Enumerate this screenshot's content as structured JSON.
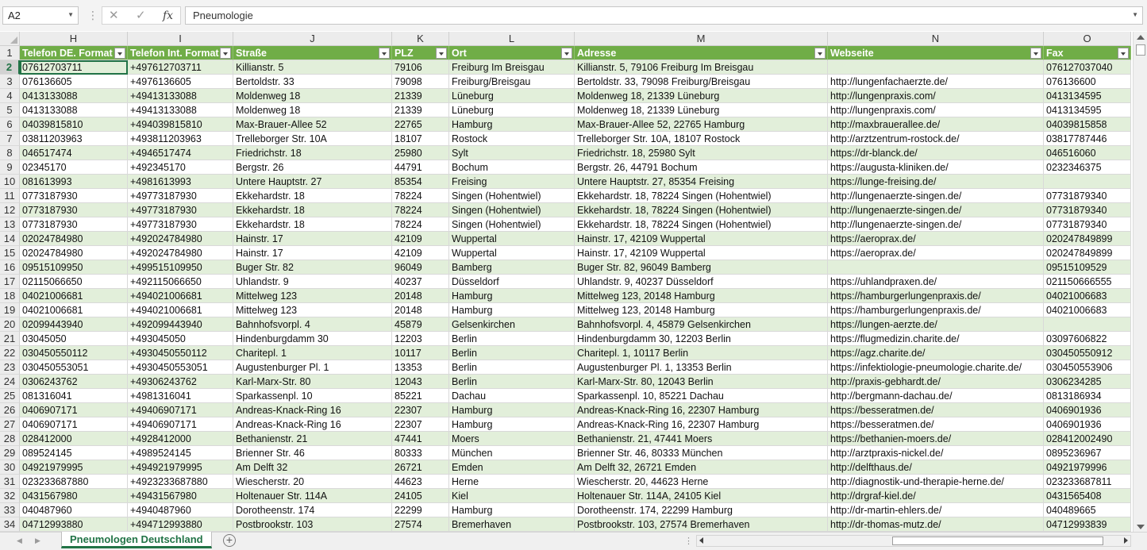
{
  "formula_bar": {
    "name_box": "A2",
    "cancel_icon": "✕",
    "enter_icon": "✓",
    "fx_label": "fx",
    "content": "Pneumologie"
  },
  "columns": [
    "H",
    "I",
    "J",
    "K",
    "L",
    "M",
    "N",
    "O"
  ],
  "header_row": {
    "number": "1",
    "cells": [
      "Telefon DE. Format",
      "Telefon Int. Format",
      "Straße",
      "PLZ",
      "Ort",
      "Adresse",
      "Webseite",
      "Fax"
    ]
  },
  "rows": [
    {
      "n": "2",
      "cells": [
        "07612703711",
        "+497612703711",
        "Killianstr. 5",
        "79106",
        "Freiburg Im Breisgau",
        "Killianstr. 5, 79106 Freiburg Im Breisgau",
        "",
        "076127037040"
      ]
    },
    {
      "n": "3",
      "cells": [
        "076136605",
        "+4976136605",
        "Bertoldstr. 33",
        "79098",
        "Freiburg/Breisgau",
        "Bertoldstr. 33, 79098 Freiburg/Breisgau",
        "http://lungenfachaerzte.de/",
        "076136600"
      ]
    },
    {
      "n": "4",
      "cells": [
        "0413133088",
        "+49413133088",
        "Moldenweg 18",
        "21339",
        "Lüneburg",
        "Moldenweg 18, 21339 Lüneburg",
        "http://lungenpraxis.com/",
        "0413134595"
      ]
    },
    {
      "n": "5",
      "cells": [
        "0413133088",
        "+49413133088",
        "Moldenweg 18",
        "21339",
        "Lüneburg",
        "Moldenweg 18, 21339 Lüneburg",
        "http://lungenpraxis.com/",
        "0413134595"
      ]
    },
    {
      "n": "6",
      "cells": [
        "04039815810",
        "+494039815810",
        "Max-Brauer-Allee 52",
        "22765",
        "Hamburg",
        "Max-Brauer-Allee 52, 22765 Hamburg",
        "http://maxbrauerallee.de/",
        "04039815858"
      ]
    },
    {
      "n": "7",
      "cells": [
        "03811203963",
        "+493811203963",
        "Trelleborger Str. 10A",
        "18107",
        "Rostock",
        "Trelleborger Str. 10A, 18107 Rostock",
        "http://arztzentrum-rostock.de/",
        "03817787446"
      ]
    },
    {
      "n": "8",
      "cells": [
        "046517474",
        "+4946517474",
        "Friedrichstr. 18",
        "25980",
        "Sylt",
        "Friedrichstr. 18, 25980 Sylt",
        "https://dr-blanck.de/",
        "046516060"
      ]
    },
    {
      "n": "9",
      "cells": [
        "02345170",
        "+492345170",
        "Bergstr. 26",
        "44791",
        "Bochum",
        "Bergstr. 26, 44791 Bochum",
        "https://augusta-kliniken.de/",
        "0232346375"
      ]
    },
    {
      "n": "10",
      "cells": [
        "081613993",
        "+4981613993",
        "Untere Hauptstr. 27",
        "85354",
        "Freising",
        "Untere Hauptstr. 27, 85354 Freising",
        "https://lunge-freising.de/",
        ""
      ]
    },
    {
      "n": "11",
      "cells": [
        "0773187930",
        "+49773187930",
        "Ekkehardstr. 18",
        "78224",
        "Singen (Hohentwiel)",
        "Ekkehardstr. 18, 78224 Singen (Hohentwiel)",
        "http://lungenaerzte-singen.de/",
        "07731879340"
      ]
    },
    {
      "n": "12",
      "cells": [
        "0773187930",
        "+49773187930",
        "Ekkehardstr. 18",
        "78224",
        "Singen (Hohentwiel)",
        "Ekkehardstr. 18, 78224 Singen (Hohentwiel)",
        "http://lungenaerzte-singen.de/",
        "07731879340"
      ]
    },
    {
      "n": "13",
      "cells": [
        "0773187930",
        "+49773187930",
        "Ekkehardstr. 18",
        "78224",
        "Singen (Hohentwiel)",
        "Ekkehardstr. 18, 78224 Singen (Hohentwiel)",
        "http://lungenaerzte-singen.de/",
        "07731879340"
      ]
    },
    {
      "n": "14",
      "cells": [
        "02024784980",
        "+492024784980",
        "Hainstr. 17",
        "42109",
        "Wuppertal",
        "Hainstr. 17, 42109 Wuppertal",
        "https://aeroprax.de/",
        "020247849899"
      ]
    },
    {
      "n": "15",
      "cells": [
        "02024784980",
        "+492024784980",
        "Hainstr. 17",
        "42109",
        "Wuppertal",
        "Hainstr. 17, 42109 Wuppertal",
        "https://aeroprax.de/",
        "020247849899"
      ]
    },
    {
      "n": "16",
      "cells": [
        "09515109950",
        "+499515109950",
        "Buger Str. 82",
        "96049",
        "Bamberg",
        "Buger Str. 82, 96049 Bamberg",
        "",
        "09515109529"
      ]
    },
    {
      "n": "17",
      "cells": [
        "02115066650",
        "+492115066650",
        "Uhlandstr. 9",
        "40237",
        "Düsseldorf",
        "Uhlandstr. 9, 40237 Düsseldorf",
        "https://uhlandpraxen.de/",
        "021150666555"
      ]
    },
    {
      "n": "18",
      "cells": [
        "04021006681",
        "+494021006681",
        "Mittelweg 123",
        "20148",
        "Hamburg",
        "Mittelweg 123, 20148 Hamburg",
        "https://hamburgerlungenpraxis.de/",
        "04021006683"
      ]
    },
    {
      "n": "19",
      "cells": [
        "04021006681",
        "+494021006681",
        "Mittelweg 123",
        "20148",
        "Hamburg",
        "Mittelweg 123, 20148 Hamburg",
        "https://hamburgerlungenpraxis.de/",
        "04021006683"
      ]
    },
    {
      "n": "20",
      "cells": [
        "02099443940",
        "+492099443940",
        "Bahnhofsvorpl. 4",
        "45879",
        "Gelsenkirchen",
        "Bahnhofsvorpl. 4, 45879 Gelsenkirchen",
        "https://lungen-aerzte.de/",
        ""
      ]
    },
    {
      "n": "21",
      "cells": [
        "03045050",
        "+493045050",
        "Hindenburgdamm 30",
        "12203",
        "Berlin",
        "Hindenburgdamm 30, 12203 Berlin",
        "https://flugmedizin.charite.de/",
        "03097606822"
      ]
    },
    {
      "n": "22",
      "cells": [
        "030450550112",
        "+4930450550112",
        "Charitepl. 1",
        "10117",
        "Berlin",
        "Charitepl. 1, 10117 Berlin",
        "https://agz.charite.de/",
        "030450550912"
      ]
    },
    {
      "n": "23",
      "cells": [
        "030450553051",
        "+4930450553051",
        "Augustenburger Pl. 1",
        "13353",
        "Berlin",
        "Augustenburger Pl. 1, 13353 Berlin",
        "https://infektiologie-pneumologie.charite.de/",
        "030450553906"
      ]
    },
    {
      "n": "24",
      "cells": [
        "0306243762",
        "+49306243762",
        "Karl-Marx-Str. 80",
        "12043",
        "Berlin",
        "Karl-Marx-Str. 80, 12043 Berlin",
        "http://praxis-gebhardt.de/",
        "0306234285"
      ]
    },
    {
      "n": "25",
      "cells": [
        "081316041",
        "+4981316041",
        "Sparkassenpl. 10",
        "85221",
        "Dachau",
        "Sparkassenpl. 10, 85221 Dachau",
        "http://bergmann-dachau.de/",
        "0813186934"
      ]
    },
    {
      "n": "26",
      "cells": [
        "0406907171",
        "+49406907171",
        "Andreas-Knack-Ring 16",
        "22307",
        "Hamburg",
        "Andreas-Knack-Ring 16, 22307 Hamburg",
        "https://besseratmen.de/",
        "0406901936"
      ]
    },
    {
      "n": "27",
      "cells": [
        "0406907171",
        "+49406907171",
        "Andreas-Knack-Ring 16",
        "22307",
        "Hamburg",
        "Andreas-Knack-Ring 16, 22307 Hamburg",
        "https://besseratmen.de/",
        "0406901936"
      ]
    },
    {
      "n": "28",
      "cells": [
        "028412000",
        "+4928412000",
        "Bethanienstr. 21",
        "47441",
        "Moers",
        "Bethanienstr. 21, 47441 Moers",
        "https://bethanien-moers.de/",
        "028412002490"
      ]
    },
    {
      "n": "29",
      "cells": [
        "089524145",
        "+4989524145",
        "Brienner Str. 46",
        "80333",
        "München",
        "Brienner Str. 46, 80333 München",
        "http://arztpraxis-nickel.de/",
        "0895236967"
      ]
    },
    {
      "n": "30",
      "cells": [
        "04921979995",
        "+494921979995",
        "Am Delft 32",
        "26721",
        "Emden",
        "Am Delft 32, 26721 Emden",
        "http://delfthaus.de/",
        "04921979996"
      ]
    },
    {
      "n": "31",
      "cells": [
        "023233687880",
        "+4923233687880",
        "Wiescherstr. 20",
        "44623",
        "Herne",
        "Wiescherstr. 20, 44623 Herne",
        "http://diagnostik-und-therapie-herne.de/",
        "023233687811"
      ]
    },
    {
      "n": "32",
      "cells": [
        "0431567980",
        "+49431567980",
        "Holtenauer Str. 114A",
        "24105",
        "Kiel",
        "Holtenauer Str. 114A, 24105 Kiel",
        "http://drgraf-kiel.de/",
        "0431565408"
      ]
    },
    {
      "n": "33",
      "cells": [
        "040487960",
        "+4940487960",
        "Dorotheenstr. 174",
        "22299",
        "Hamburg",
        "Dorotheenstr. 174, 22299 Hamburg",
        "http://dr-martin-ehlers.de/",
        "040489665"
      ]
    },
    {
      "n": "34",
      "cells": [
        "04712993880",
        "+494712993880",
        "Postbrookstr. 103",
        "27574",
        "Bremerhaven",
        "Postbrookstr. 103, 27574 Bremerhaven",
        "http://dr-thomas-mutz.de/",
        "04712993839"
      ]
    }
  ],
  "sheet_tabs": {
    "active": "Pneumologen Deutschland",
    "add_icon": "+"
  },
  "colors": {
    "header_fill": "#70ad47",
    "band_fill": "#e2efda",
    "accent": "#217346"
  }
}
